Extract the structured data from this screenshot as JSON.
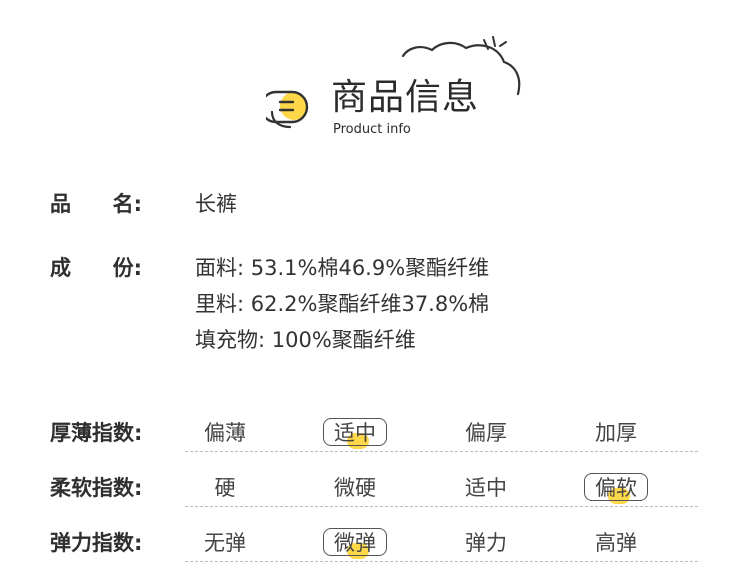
{
  "header": {
    "title": "商品信息",
    "subtitle": "Product info",
    "logo_icon": "menu-lines-icon",
    "decoration_icon": "cloud-doodle-icon",
    "accent_color": "#ffd84a"
  },
  "product_name": {
    "label_a": "品",
    "label_b": "名:",
    "value": "长裤"
  },
  "composition": {
    "label_a": "成",
    "label_b": "份:",
    "lines": [
      "面料: 53.1%棉46.9%聚酯纤维",
      "里料: 62.2%聚酯纤维37.8%棉",
      "填充物: 100%聚酯纤维"
    ]
  },
  "ratings": [
    {
      "label": "厚薄指数:",
      "options": [
        "偏薄",
        "适中",
        "偏厚",
        "加厚"
      ],
      "selected": "适中"
    },
    {
      "label": "柔软指数:",
      "options": [
        "硬",
        "微硬",
        "适中",
        "偏软"
      ],
      "selected": "偏软"
    },
    {
      "label": "弹力指数:",
      "options": [
        "无弹",
        "微弹",
        "弹力",
        "高弹"
      ],
      "selected": "微弹"
    }
  ]
}
